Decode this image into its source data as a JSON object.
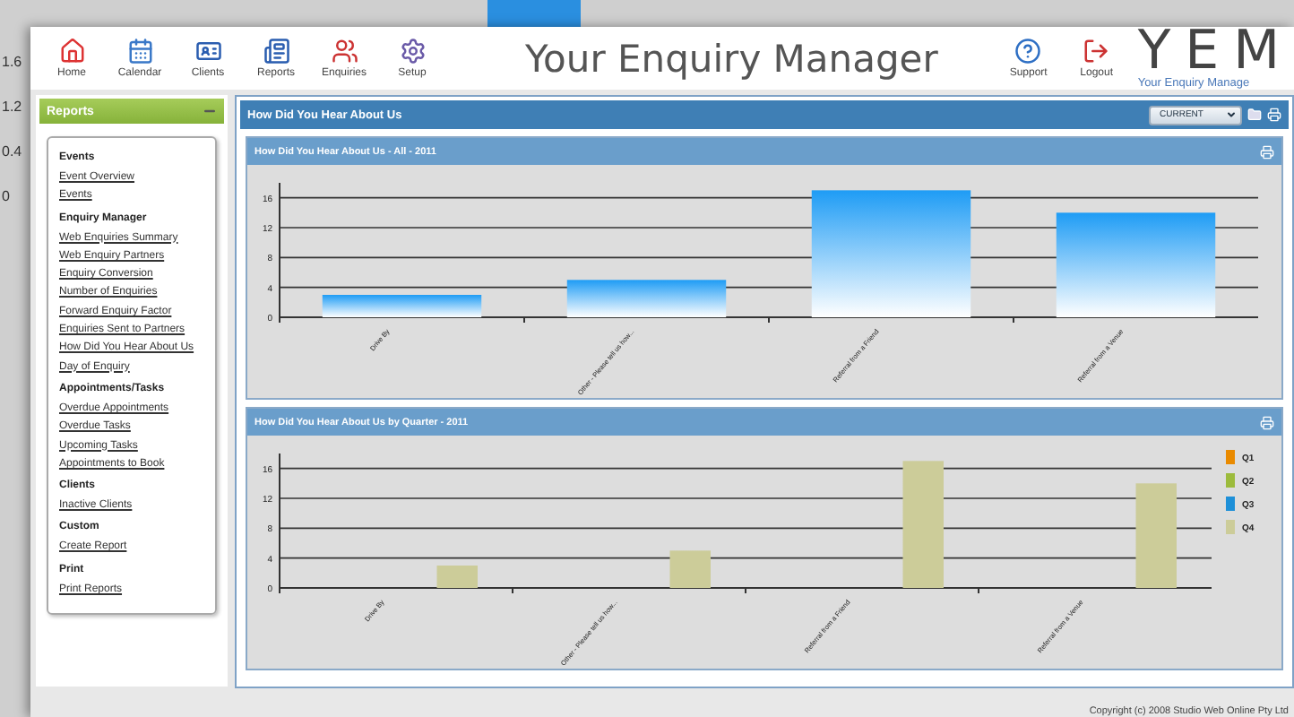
{
  "background_window": {
    "axis_labels": [
      "1.6",
      "1.2",
      "0.4",
      "0"
    ]
  },
  "window": {
    "title": "Your Enquiry Manager"
  },
  "nav": [
    {
      "label": "Home"
    },
    {
      "label": "Calendar"
    },
    {
      "label": "Clients"
    },
    {
      "label": "Reports"
    },
    {
      "label": "Enquiries"
    },
    {
      "label": "Setup"
    }
  ],
  "header_actions": [
    {
      "label": "Support"
    },
    {
      "label": "Logout"
    }
  ],
  "logo": {
    "letters": "YEM",
    "tagline": "Your Enquiry Manage"
  },
  "sidebar": {
    "title": "Reports",
    "sections": [
      {
        "heading": "Events",
        "links": [
          "Event Overview",
          "Events"
        ]
      },
      {
        "heading": "Enquiry Manager",
        "links": [
          "Web Enquiries Summary",
          "Web Enquiry Partners",
          "Enquiry Conversion",
          "Number of Enquiries",
          "Forward Enquiry Factor",
          "Enquiries Sent to Partners",
          "How Did You Hear About Us",
          "Day of Enquiry"
        ]
      },
      {
        "heading": "Appointments/Tasks",
        "links": [
          "Overdue Appointments",
          "Overdue Tasks",
          "Upcoming Tasks",
          "Appointments to Book"
        ]
      },
      {
        "heading": "Clients",
        "links": [
          "Inactive Clients"
        ]
      },
      {
        "heading": "Custom",
        "links": [
          "Create Report"
        ]
      },
      {
        "heading": "Print",
        "links": [
          "Print Reports"
        ]
      }
    ]
  },
  "content": {
    "title": "How Did You Hear About Us",
    "period": "CURRENT",
    "panels": [
      {
        "title": "How Did You Hear About Us - All - 2011",
        "chart_data": {
          "type": "bar",
          "categories": [
            "Drive By",
            "Other - Please tell us how...",
            "Referral from a Friend",
            "Referral from a Venue"
          ],
          "series": [
            {
              "color": "#1e9cf5",
              "values": [
                3,
                5,
                17,
                14
              ]
            }
          ],
          "ylim": [
            0,
            18
          ],
          "yticks": [
            0,
            4,
            8,
            12,
            16
          ],
          "grid": true
        }
      },
      {
        "title": "How Did You Hear About Us by Quarter - 2011",
        "chart_data": {
          "type": "bar",
          "categories": [
            "Drive By",
            "Other - Please tell us how...",
            "Referral from a Friend",
            "Referral from a Venue"
          ],
          "series": [
            {
              "name": "Q1",
              "color": "#e98a00",
              "values": [
                null,
                null,
                null,
                null
              ]
            },
            {
              "name": "Q2",
              "color": "#9cbb3c",
              "values": [
                null,
                null,
                null,
                null
              ]
            },
            {
              "name": "Q3",
              "color": "#1e90d8",
              "values": [
                null,
                null,
                null,
                null
              ]
            },
            {
              "name": "Q4",
              "color": "#cccc99",
              "values": [
                3,
                5,
                17,
                14
              ]
            }
          ],
          "ylim": [
            0,
            18
          ],
          "yticks": [
            0,
            4,
            8,
            12,
            16
          ],
          "grid": true
        }
      }
    ]
  },
  "footer": "Copyright (c) 2008 Studio Web Online Pty Ltd"
}
